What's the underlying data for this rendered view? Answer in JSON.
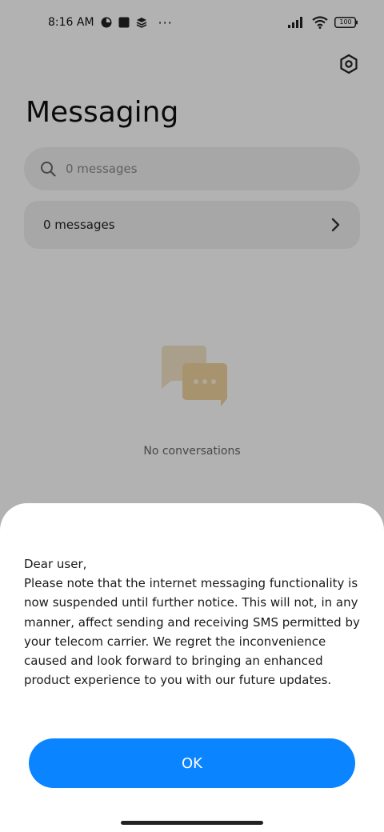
{
  "status_bar": {
    "time": "8:16 AM",
    "more_indicator": "···",
    "battery": "100",
    "icons": [
      "app-notification-icon",
      "square-notification-icon",
      "layers-notification-icon",
      "signal-icon",
      "wifi-icon",
      "battery-icon"
    ]
  },
  "header": {
    "title": "Messaging",
    "settings_icon": "settings-hexagon-icon"
  },
  "search": {
    "placeholder": "0 messages",
    "icon": "search-icon"
  },
  "messages_row": {
    "label": "0 messages",
    "icon": "chevron-right-icon"
  },
  "empty_state": {
    "icon": "chat-bubbles-icon",
    "text": "No conversations"
  },
  "dialog": {
    "message": "Dear user,\nPlease note that the internet messaging functionality is now suspended until further notice. This will not, in any manner, affect sending and receiving SMS permitted by your telecom carrier. We regret the inconvenience caused and look forward to bringing an enhanced product experience to you with our future updates.",
    "ok_label": "OK"
  },
  "colors": {
    "accent": "#0a84ff",
    "dim_overlay": "rgba(0,0,0,0.30)",
    "empty_icon": "#f2d9a8"
  }
}
